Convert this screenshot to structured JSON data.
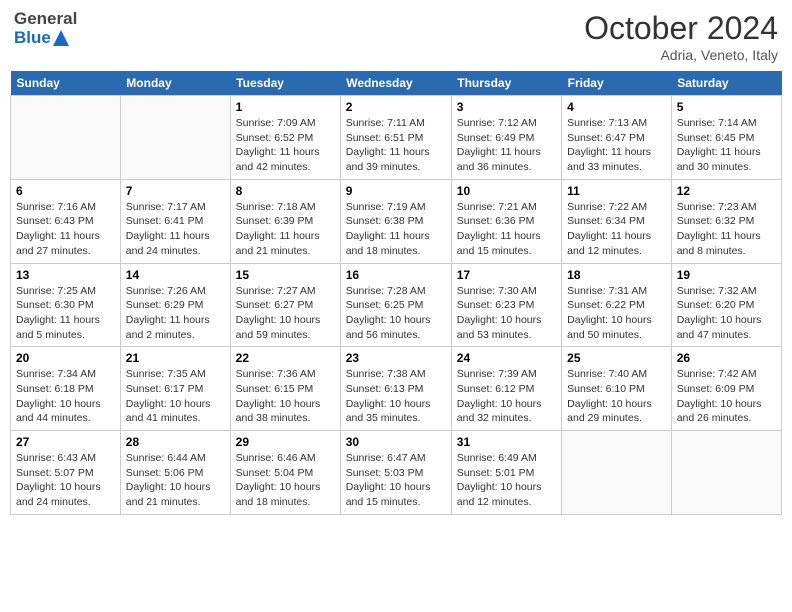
{
  "header": {
    "logo": {
      "general": "General",
      "blue": "Blue"
    },
    "month": "October 2024",
    "location": "Adria, Veneto, Italy"
  },
  "days_of_week": [
    "Sunday",
    "Monday",
    "Tuesday",
    "Wednesday",
    "Thursday",
    "Friday",
    "Saturday"
  ],
  "weeks": [
    [
      {
        "num": "",
        "empty": true
      },
      {
        "num": "",
        "empty": true
      },
      {
        "num": "1",
        "sunrise": "Sunrise: 7:09 AM",
        "sunset": "Sunset: 6:52 PM",
        "daylight": "Daylight: 11 hours and 42 minutes."
      },
      {
        "num": "2",
        "sunrise": "Sunrise: 7:11 AM",
        "sunset": "Sunset: 6:51 PM",
        "daylight": "Daylight: 11 hours and 39 minutes."
      },
      {
        "num": "3",
        "sunrise": "Sunrise: 7:12 AM",
        "sunset": "Sunset: 6:49 PM",
        "daylight": "Daylight: 11 hours and 36 minutes."
      },
      {
        "num": "4",
        "sunrise": "Sunrise: 7:13 AM",
        "sunset": "Sunset: 6:47 PM",
        "daylight": "Daylight: 11 hours and 33 minutes."
      },
      {
        "num": "5",
        "sunrise": "Sunrise: 7:14 AM",
        "sunset": "Sunset: 6:45 PM",
        "daylight": "Daylight: 11 hours and 30 minutes."
      }
    ],
    [
      {
        "num": "6",
        "sunrise": "Sunrise: 7:16 AM",
        "sunset": "Sunset: 6:43 PM",
        "daylight": "Daylight: 11 hours and 27 minutes."
      },
      {
        "num": "7",
        "sunrise": "Sunrise: 7:17 AM",
        "sunset": "Sunset: 6:41 PM",
        "daylight": "Daylight: 11 hours and 24 minutes."
      },
      {
        "num": "8",
        "sunrise": "Sunrise: 7:18 AM",
        "sunset": "Sunset: 6:39 PM",
        "daylight": "Daylight: 11 hours and 21 minutes."
      },
      {
        "num": "9",
        "sunrise": "Sunrise: 7:19 AM",
        "sunset": "Sunset: 6:38 PM",
        "daylight": "Daylight: 11 hours and 18 minutes."
      },
      {
        "num": "10",
        "sunrise": "Sunrise: 7:21 AM",
        "sunset": "Sunset: 6:36 PM",
        "daylight": "Daylight: 11 hours and 15 minutes."
      },
      {
        "num": "11",
        "sunrise": "Sunrise: 7:22 AM",
        "sunset": "Sunset: 6:34 PM",
        "daylight": "Daylight: 11 hours and 12 minutes."
      },
      {
        "num": "12",
        "sunrise": "Sunrise: 7:23 AM",
        "sunset": "Sunset: 6:32 PM",
        "daylight": "Daylight: 11 hours and 8 minutes."
      }
    ],
    [
      {
        "num": "13",
        "sunrise": "Sunrise: 7:25 AM",
        "sunset": "Sunset: 6:30 PM",
        "daylight": "Daylight: 11 hours and 5 minutes."
      },
      {
        "num": "14",
        "sunrise": "Sunrise: 7:26 AM",
        "sunset": "Sunset: 6:29 PM",
        "daylight": "Daylight: 11 hours and 2 minutes."
      },
      {
        "num": "15",
        "sunrise": "Sunrise: 7:27 AM",
        "sunset": "Sunset: 6:27 PM",
        "daylight": "Daylight: 10 hours and 59 minutes."
      },
      {
        "num": "16",
        "sunrise": "Sunrise: 7:28 AM",
        "sunset": "Sunset: 6:25 PM",
        "daylight": "Daylight: 10 hours and 56 minutes."
      },
      {
        "num": "17",
        "sunrise": "Sunrise: 7:30 AM",
        "sunset": "Sunset: 6:23 PM",
        "daylight": "Daylight: 10 hours and 53 minutes."
      },
      {
        "num": "18",
        "sunrise": "Sunrise: 7:31 AM",
        "sunset": "Sunset: 6:22 PM",
        "daylight": "Daylight: 10 hours and 50 minutes."
      },
      {
        "num": "19",
        "sunrise": "Sunrise: 7:32 AM",
        "sunset": "Sunset: 6:20 PM",
        "daylight": "Daylight: 10 hours and 47 minutes."
      }
    ],
    [
      {
        "num": "20",
        "sunrise": "Sunrise: 7:34 AM",
        "sunset": "Sunset: 6:18 PM",
        "daylight": "Daylight: 10 hours and 44 minutes."
      },
      {
        "num": "21",
        "sunrise": "Sunrise: 7:35 AM",
        "sunset": "Sunset: 6:17 PM",
        "daylight": "Daylight: 10 hours and 41 minutes."
      },
      {
        "num": "22",
        "sunrise": "Sunrise: 7:36 AM",
        "sunset": "Sunset: 6:15 PM",
        "daylight": "Daylight: 10 hours and 38 minutes."
      },
      {
        "num": "23",
        "sunrise": "Sunrise: 7:38 AM",
        "sunset": "Sunset: 6:13 PM",
        "daylight": "Daylight: 10 hours and 35 minutes."
      },
      {
        "num": "24",
        "sunrise": "Sunrise: 7:39 AM",
        "sunset": "Sunset: 6:12 PM",
        "daylight": "Daylight: 10 hours and 32 minutes."
      },
      {
        "num": "25",
        "sunrise": "Sunrise: 7:40 AM",
        "sunset": "Sunset: 6:10 PM",
        "daylight": "Daylight: 10 hours and 29 minutes."
      },
      {
        "num": "26",
        "sunrise": "Sunrise: 7:42 AM",
        "sunset": "Sunset: 6:09 PM",
        "daylight": "Daylight: 10 hours and 26 minutes."
      }
    ],
    [
      {
        "num": "27",
        "sunrise": "Sunrise: 6:43 AM",
        "sunset": "Sunset: 5:07 PM",
        "daylight": "Daylight: 10 hours and 24 minutes."
      },
      {
        "num": "28",
        "sunrise": "Sunrise: 6:44 AM",
        "sunset": "Sunset: 5:06 PM",
        "daylight": "Daylight: 10 hours and 21 minutes."
      },
      {
        "num": "29",
        "sunrise": "Sunrise: 6:46 AM",
        "sunset": "Sunset: 5:04 PM",
        "daylight": "Daylight: 10 hours and 18 minutes."
      },
      {
        "num": "30",
        "sunrise": "Sunrise: 6:47 AM",
        "sunset": "Sunset: 5:03 PM",
        "daylight": "Daylight: 10 hours and 15 minutes."
      },
      {
        "num": "31",
        "sunrise": "Sunrise: 6:49 AM",
        "sunset": "Sunset: 5:01 PM",
        "daylight": "Daylight: 10 hours and 12 minutes."
      },
      {
        "num": "",
        "empty": true
      },
      {
        "num": "",
        "empty": true
      }
    ]
  ]
}
